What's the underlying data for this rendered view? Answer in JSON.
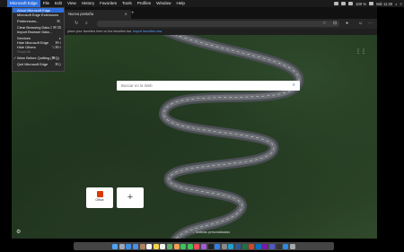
{
  "menubar": {
    "items": [
      "Microsoft Edge",
      "File",
      "Edit",
      "View",
      "History",
      "Favorites",
      "Tools",
      "Profiles",
      "Window",
      "Help"
    ],
    "right": {
      "battery": "100 %",
      "clock": "Mié 11:30"
    }
  },
  "browser": {
    "tab_title": "Nueva pestaña",
    "fav_hint": "place your favorites here on the favorites bar.",
    "fav_link": "Import favorites now"
  },
  "newtab": {
    "search_placeholder": "Buscar en la Web",
    "tile_office": "Office",
    "tile_add": "+",
    "news_label": "Noticias personalizadas"
  },
  "app_menu": {
    "items": [
      {
        "label": "About Microsoft Edge",
        "shortcut": "",
        "state": "highlighted"
      },
      {
        "label": "Microsoft Edge Extensions",
        "shortcut": "",
        "state": "normal"
      },
      {
        "sep": true
      },
      {
        "label": "Preferences...",
        "shortcut": "⌘,",
        "state": "normal"
      },
      {
        "sep": true
      },
      {
        "label": "Clear Browsing Data...",
        "shortcut": "⇧⌘⌫",
        "state": "normal"
      },
      {
        "label": "Import Browser Data...",
        "shortcut": "",
        "state": "normal"
      },
      {
        "sep": true
      },
      {
        "label": "Services",
        "shortcut": "▸",
        "state": "normal"
      },
      {
        "label": "Hide Microsoft Edge",
        "shortcut": "⌘H",
        "state": "normal"
      },
      {
        "label": "Hide Others",
        "shortcut": "⌥⌘H",
        "state": "normal"
      },
      {
        "label": "Show All",
        "shortcut": "",
        "state": "disabled"
      },
      {
        "sep": true
      },
      {
        "label": "Warn Before Quitting (⌘Q)",
        "shortcut": "",
        "state": "checked"
      },
      {
        "sep": true
      },
      {
        "label": "Quit Microsoft Edge",
        "shortcut": "⌘Q",
        "state": "normal"
      }
    ]
  },
  "dock": {
    "apps": [
      "finder",
      "launchpad",
      "safari",
      "mail",
      "contacts",
      "calendar",
      "notes",
      "reminders",
      "maps",
      "photos",
      "messages",
      "facetime",
      "music",
      "podcasts",
      "tv",
      "app-store",
      "preferences",
      "edge",
      "word",
      "excel",
      "powerpoint",
      "outlook",
      "onenote",
      "teams",
      "terminal",
      "downloads",
      "trash"
    ],
    "colors": [
      "#4aa3ff",
      "#9aa7b5",
      "#3a8ee6",
      "#4b8fe8",
      "#b08060",
      "#f4f4f4",
      "#f5d44a",
      "#f2f2f2",
      "#57b36a",
      "#f0a050",
      "#3ac45a",
      "#3ac45a",
      "#f04a5a",
      "#a25ce0",
      "#222222",
      "#2f80ee",
      "#8a8a8a",
      "#1fa0d0",
      "#2b5797",
      "#1f7244",
      "#d24726",
      "#0072c6",
      "#7719aa",
      "#5059c9",
      "#333333",
      "#2d8be0",
      "#aaaaaa"
    ]
  }
}
